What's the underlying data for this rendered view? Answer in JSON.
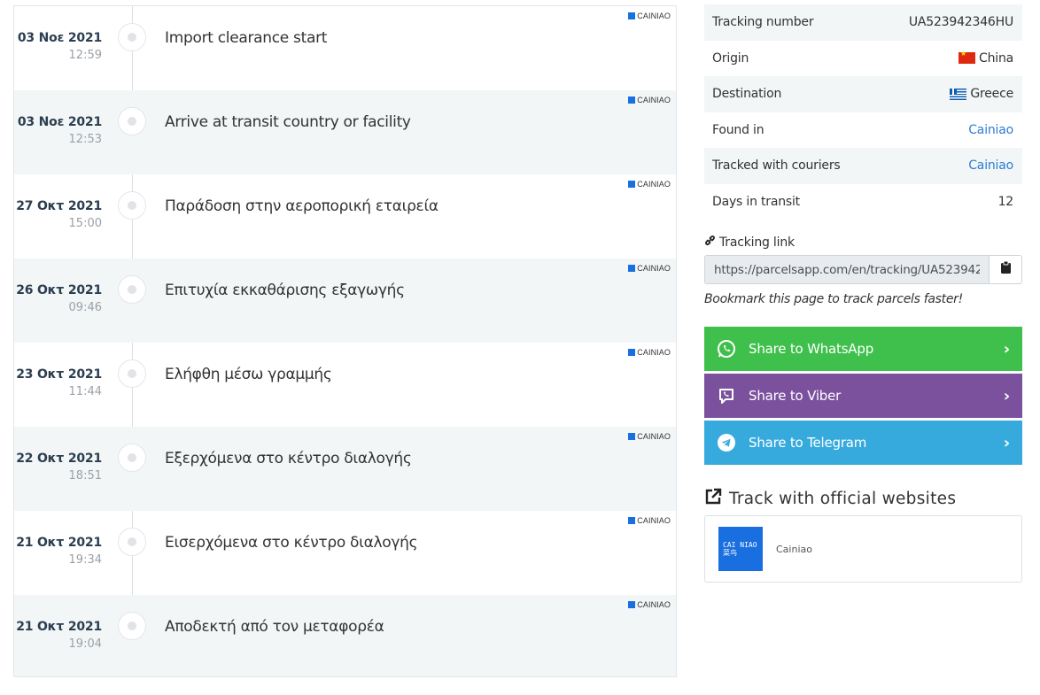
{
  "events": [
    {
      "date": "03 Νοε 2021",
      "time": "12:59",
      "title": "Import clearance start",
      "source": "CAINIAO"
    },
    {
      "date": "03 Νοε 2021",
      "time": "12:53",
      "title": "Arrive at transit country or facility",
      "source": "CAINIAO"
    },
    {
      "date": "27 Οκτ 2021",
      "time": "15:00",
      "title": "Παράδοση στην αεροπορική εταιρεία",
      "source": "CAINIAO"
    },
    {
      "date": "26 Οκτ 2021",
      "time": "09:46",
      "title": "Επιτυχία εκκαθάρισης εξαγωγής",
      "source": "CAINIAO"
    },
    {
      "date": "23 Οκτ 2021",
      "time": "11:44",
      "title": "Ελήφθη μέσω γραμμής",
      "source": "CAINIAO"
    },
    {
      "date": "22 Οκτ 2021",
      "time": "18:51",
      "title": "Εξερχόμενα στο κέντρο διαλογής",
      "source": "CAINIAO"
    },
    {
      "date": "21 Οκτ 2021",
      "time": "19:34",
      "title": "Εισερχόμενα στο κέντρο διαλογής",
      "source": "CAINIAO"
    },
    {
      "date": "21 Οκτ 2021",
      "time": "19:04",
      "title": "Αποδεκτή από τον μεταφορέα",
      "source": "CAINIAO"
    }
  ],
  "info": {
    "tracking_number": {
      "label": "Tracking number",
      "value": "UA523942346HU"
    },
    "origin": {
      "label": "Origin",
      "value": "China"
    },
    "destination": {
      "label": "Destination",
      "value": "Greece"
    },
    "found_in": {
      "label": "Found in",
      "value": "Cainiao"
    },
    "tracked_with": {
      "label": "Tracked with couriers",
      "value": "Cainiao"
    },
    "days_in_transit": {
      "label": "Days in transit",
      "value": "12"
    }
  },
  "tracking_link": {
    "label": "Tracking link",
    "url": "https://parcelsapp.com/en/tracking/UA523942",
    "bookmark_hint": "Bookmark this page to track parcels faster!"
  },
  "share": {
    "whatsapp": "Share to WhatsApp",
    "viber": "Share to Viber",
    "telegram": "Share to Telegram"
  },
  "official": {
    "title": "Track with official websites",
    "courier_name": "Cainiao",
    "logo_text": "CAI NIAO 菜鸟"
  },
  "colors": {
    "whatsapp": "#3fbf4b",
    "viber": "#7b519d",
    "telegram": "#37aadd",
    "link": "#2d7dd2",
    "cainiao": "#1a6fe0"
  }
}
